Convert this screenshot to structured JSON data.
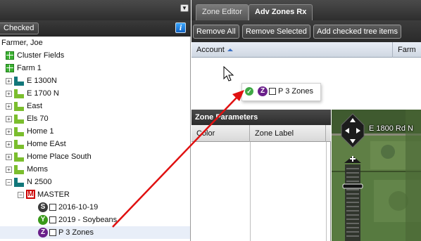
{
  "left_panel": {
    "checked_button": "Checked",
    "info_button": "i"
  },
  "tree": [
    {
      "label": "Farmer, Joe",
      "icon": "none",
      "expander": ""
    },
    {
      "label": "Cluster Fields",
      "icon": "grid",
      "expander": ""
    },
    {
      "label": "Farm 1",
      "icon": "grid",
      "expander": ""
    },
    {
      "label": "E 1300N",
      "icon": "field-teal",
      "expander": "+"
    },
    {
      "label": "E 1700 N",
      "icon": "field-green",
      "expander": "+"
    },
    {
      "label": "East",
      "icon": "field-green",
      "expander": "+"
    },
    {
      "label": "Els 70",
      "icon": "field-green",
      "expander": "+"
    },
    {
      "label": "Home 1",
      "icon": "field-green",
      "expander": "+"
    },
    {
      "label": "Home EAst",
      "icon": "field-green",
      "expander": "+"
    },
    {
      "label": "Home Place South",
      "icon": "field-green",
      "expander": "+"
    },
    {
      "label": "Moms",
      "icon": "field-green",
      "expander": "+"
    },
    {
      "label": "N 2500",
      "icon": "field-teal",
      "expander": "−"
    },
    {
      "label": "MASTER",
      "icon": "M",
      "expander": "−"
    },
    {
      "label": "2016-10-19",
      "icon": "S",
      "expander": ""
    },
    {
      "label": "2019 - Soybeans",
      "icon": "Y",
      "expander": ""
    },
    {
      "label": "P 3 Zones",
      "icon": "Z",
      "expander": ""
    }
  ],
  "tabs": [
    "Zone Editor",
    "Adv Zones Rx"
  ],
  "toolbar": {
    "remove_all": "Remove All",
    "remove_selected": "Remove Selected",
    "add_checked": "Add checked tree items"
  },
  "grid": {
    "columns": [
      "Account",
      "Farm"
    ]
  },
  "drag_item": {
    "badge": "Z",
    "label": "P 3 Zones"
  },
  "zone_parameters": {
    "title": "Zone Parameters",
    "columns": [
      "Color",
      "Zone Label"
    ]
  },
  "map": {
    "road_label": "E 1800 Rd N"
  },
  "colors": {
    "annotation_arrow": "#e01010",
    "z_badge": "#6a1f8a",
    "m_badge": "#cc0000"
  }
}
